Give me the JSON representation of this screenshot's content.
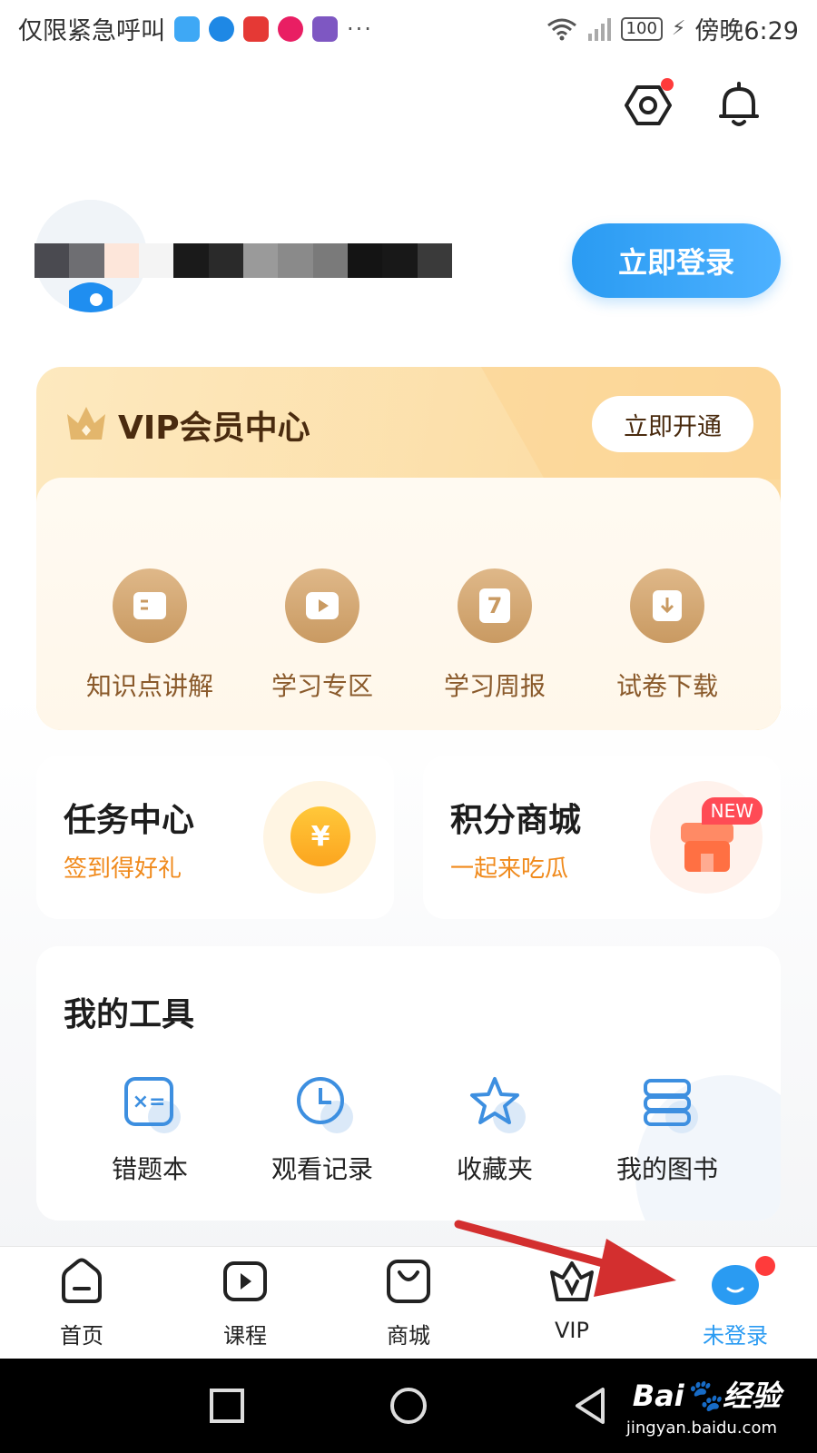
{
  "status_bar": {
    "left_text": "仅限紧急呼叫",
    "more": "···",
    "battery": "100",
    "time": "傍晚6:29",
    "app_icon_colors": [
      "#3ea8f5",
      "#1e88e5",
      "#e53935",
      "#e91e63",
      "#7e57c2"
    ]
  },
  "header": {
    "settings_icon": "settings-icon",
    "bell_icon": "bell-icon"
  },
  "profile": {
    "login_button": "立即登录"
  },
  "vip": {
    "title": "VIP会员中心",
    "open_button": "立即开通",
    "items": [
      {
        "label": "知识点讲解",
        "icon": "book-icon"
      },
      {
        "label": "学习专区",
        "icon": "play-icon"
      },
      {
        "label": "学习周报",
        "icon": "calendar-7-icon",
        "glyph": "7"
      },
      {
        "label": "试卷下载",
        "icon": "download-icon"
      }
    ]
  },
  "task_center": {
    "title": "任务中心",
    "subtitle": "签到得好礼",
    "coin_glyph": "¥"
  },
  "points_mall": {
    "title": "积分商城",
    "subtitle": "一起来吃瓜",
    "badge": "NEW"
  },
  "tools": {
    "title": "我的工具",
    "items": [
      {
        "label": "错题本",
        "icon": "wrong-questions-icon",
        "glyph": "×="
      },
      {
        "label": "观看记录",
        "icon": "clock-icon"
      },
      {
        "label": "收藏夹",
        "icon": "star-icon"
      },
      {
        "label": "我的图书",
        "icon": "books-icon"
      }
    ]
  },
  "bottom_nav": {
    "items": [
      {
        "label": "首页",
        "icon": "home-icon"
      },
      {
        "label": "课程",
        "icon": "course-play-icon"
      },
      {
        "label": "商城",
        "icon": "shop-bag-icon"
      },
      {
        "label": "VIP",
        "icon": "vip-basket-icon"
      },
      {
        "label": "未登录",
        "icon": "user-avatar-icon",
        "active": true
      }
    ]
  },
  "watermark": {
    "brand": "Bai",
    "cn": "经验",
    "url": "jingyan.baidu.com"
  },
  "colors": {
    "accent": "#2a9bf2",
    "vip_gold": "#fcd89a",
    "orange": "#f08a1c",
    "annotation_arrow": "#d32f2f"
  }
}
